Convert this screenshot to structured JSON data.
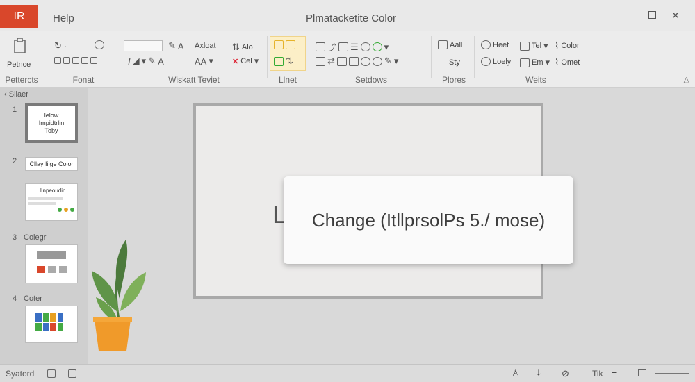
{
  "titlebar": {
    "app_badge": "IR",
    "menu_help": "Help",
    "doc_title": "Plmatacketite Color",
    "restore_icon": "square-icon",
    "close_glyph": "✕"
  },
  "ribbon": {
    "group_labels": [
      "Pettercts",
      "Fonat",
      "Wiskatt Teviet",
      "Llnet",
      "Setdows",
      "Plores",
      "Weits"
    ],
    "paste_label": "Petnce",
    "wisk_items": [
      "Axloat",
      "Alo",
      "Cel"
    ],
    "plores_items": [
      "Aall",
      "Sty"
    ],
    "weits_items": [
      "Heet",
      "Tel",
      "Color",
      "Loely",
      "Em",
      "Omet"
    ]
  },
  "sidebar": {
    "header": "Sllaer",
    "slide_numbers": [
      "1",
      "2",
      "3",
      "4"
    ],
    "thumb1_text": "lelow\nImpidtrlin\nToby",
    "thumb2_text": "Cllay Iilge Color",
    "thumb3_text": "Lllnpeoudin",
    "section_colegr": "Colegr",
    "section_coler": "Coter"
  },
  "canvas": {
    "slide_letter": "L",
    "tooltip_text": "Change (ItllprsolPs 5./ mose)"
  },
  "statusbar": {
    "left_text": "Syatord",
    "zoom_label": "Tik"
  }
}
